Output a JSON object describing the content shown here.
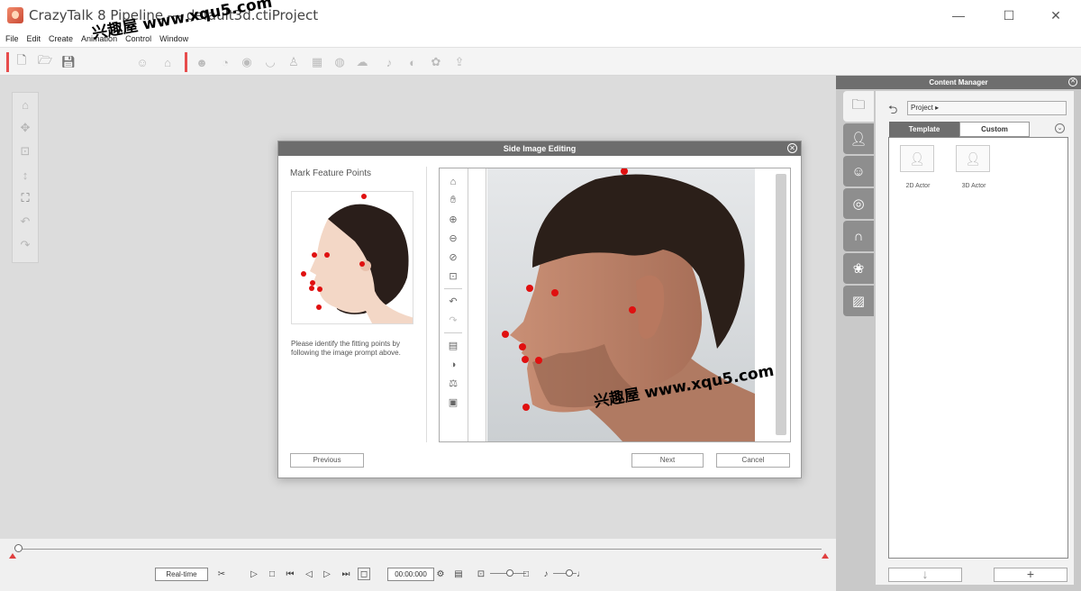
{
  "window": {
    "title": "CrazyTalk 8 Pipeline --- default3d.ctiProject",
    "minimize": "—",
    "maximize": "☐",
    "close": "✕"
  },
  "menu": [
    "File",
    "Edit",
    "Create",
    "Animation",
    "Control",
    "Window"
  ],
  "watermark": "兴趣屋 www.xqu5.com",
  "dialog": {
    "title": "Side Image Editing",
    "close": "✕",
    "section_title": "Mark Feature Points",
    "help_text": "Please identify the fitting points by following the image prompt above.",
    "previous_label": "Previous",
    "next_label": "Next",
    "cancel_label": "Cancel"
  },
  "timeline": {
    "realtime_label": "Real-time",
    "time_value": "00:00:000"
  },
  "content_manager": {
    "title": "Content Manager",
    "close": "✕",
    "path": "Project",
    "tab_template": "Template",
    "tab_custom": "Custom",
    "collapse": "⌄",
    "items": [
      {
        "label": "2D Actor"
      },
      {
        "label": "3D Actor"
      }
    ],
    "download_label": "↓",
    "add_label": "+"
  },
  "colors": {
    "accent_red": "#e74c4c",
    "dialog_header": "#6d6d6d",
    "feature_point": "#e01010"
  }
}
